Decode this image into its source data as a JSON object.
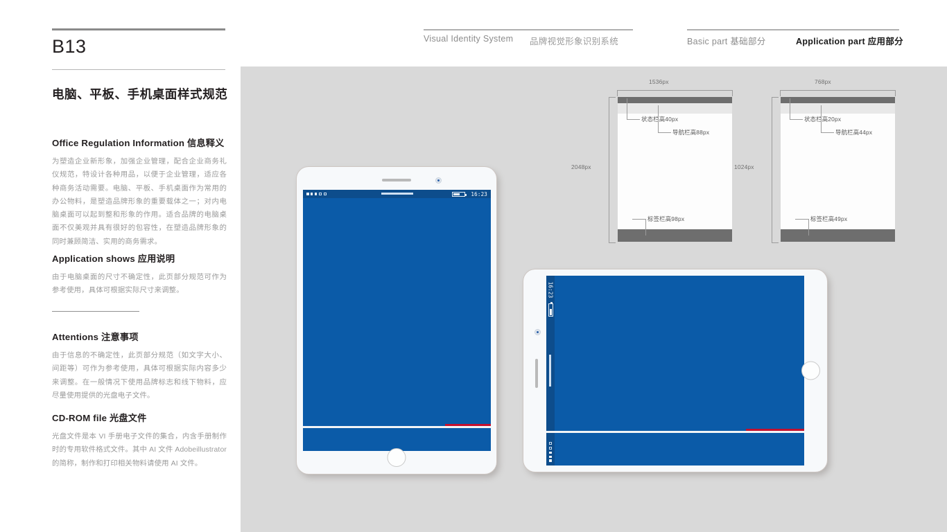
{
  "page": {
    "code": "B13",
    "title": "电脑、平板、手机桌面样式规范"
  },
  "header": {
    "nav": {
      "visual_identity_en": "Visual Identity System",
      "visual_identity_cn": "品牌视觉形象识别系统",
      "basic_part": "Basic part  基础部分",
      "application_part": "Application part  应用部分"
    }
  },
  "sections": [
    {
      "id": "office",
      "heading": "Office Regulation Information 信息释义",
      "body": "为塑造企业新形象，加强企业管理，配合企业商务礼仪规范，特设计各种用品，以便于企业管理，适应各种商务活动需要。电脑、平板、手机桌面作为常用的办公物料，是塑造品牌形象的重要载体之一；对内电脑桌面可以起到整和形象的作用。适合品牌的电脑桌面不仅美观并具有很好的包容性，在塑造品牌形象的同时兼顾简洁、实用的商务需求。"
    },
    {
      "id": "appshow",
      "heading": "Application shows 应用说明",
      "body": "由于电脑桌面的尺寸不确定性，此页部分规范可作为参考使用，具体可根据实际尺寸来调整。"
    },
    {
      "id": "attentions",
      "heading": "Attentions 注意事项",
      "body": "由于信息的不确定性，此页部分规范（如文字大小、间距等）可作为参考使用，具体可根据实际内容多少来调整。在一般情况下使用品牌标志和线下物料，应尽量使用提供的光盘电子文件。"
    },
    {
      "id": "cdrom",
      "heading": "CD-ROM file 光盘文件",
      "body": "光盘文件是本 VI 手册电子文件的集合，内含手册制作时的专用软件格式文件。其中 AI 文件 Adobeillustrator 的简称，制作和打印相关物料请使用 AI 文件。"
    }
  ],
  "spec_diagrams": [
    {
      "id": "ipad-retina",
      "width_label": "1536px",
      "height_label": "2048px",
      "annotations": [
        {
          "key": "status",
          "label": "状态栏高40px"
        },
        {
          "key": "nav",
          "label": "导航栏高88px"
        },
        {
          "key": "tab",
          "label": "标签栏高98px"
        }
      ]
    },
    {
      "id": "ipad-standard",
      "width_label": "768px",
      "height_label": "1024px",
      "annotations": [
        {
          "key": "status",
          "label": "状态栏高20px"
        },
        {
          "key": "nav",
          "label": "导航栏高44px"
        },
        {
          "key": "tab",
          "label": "标签栏高49px"
        }
      ]
    }
  ],
  "devices": {
    "portrait_tablet": {
      "status_bar": {
        "time": "16:23"
      }
    },
    "landscape_tablet": {
      "status_bar": {
        "time": "16:23"
      }
    }
  },
  "colors": {
    "screen_blue": "#0B5BA8",
    "status_bar_blue": "#0D4D8C",
    "accent_red": "#C4102E",
    "panel_gray": "#D9D9D9",
    "bar_dark_gray": "#6E6E6E",
    "bar_light_gray": "#E8E8E8"
  }
}
